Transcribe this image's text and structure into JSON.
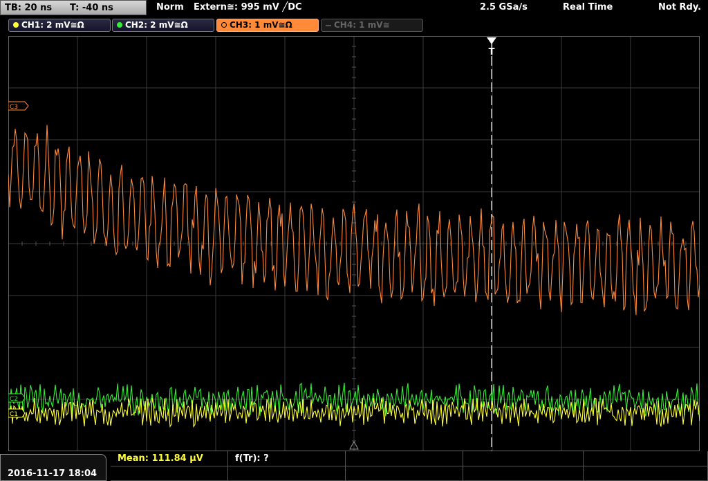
{
  "header": {
    "timebase": "TB: 20 ns",
    "trigger_time": "T: -40 ns",
    "mode": "Norm",
    "trigger_source": "Extern≅: 995 mV ╱DC",
    "sample_rate": "2.5 GSa/s",
    "acq_mode": "Real Time",
    "status": "Not Rdy."
  },
  "channels": [
    {
      "label": "CH1: 2 mV≅Ω",
      "color": "#ffff33",
      "state": "on"
    },
    {
      "label": "CH2: 2 mV≅Ω",
      "color": "#33ee33",
      "state": "on"
    },
    {
      "label": "CH3: 1 mV≅Ω",
      "color": "#ff8a3a",
      "state": "active"
    },
    {
      "label": "CH4: 1 mV≅",
      "color": "#555555",
      "state": "off"
    }
  ],
  "markers": {
    "ch3": "C3",
    "ch2": "C2",
    "ch1": "C1",
    "trigger": "T"
  },
  "measurement": {
    "mean": "Mean: 111.84 µV",
    "freq": "f(Tr): ?"
  },
  "datetime": "2016-11-17 18:04",
  "colors": {
    "ch1": "#ffff33",
    "ch2": "#33ee33",
    "ch3": "#ff8a3a",
    "grid": "#3a3a3a"
  }
}
